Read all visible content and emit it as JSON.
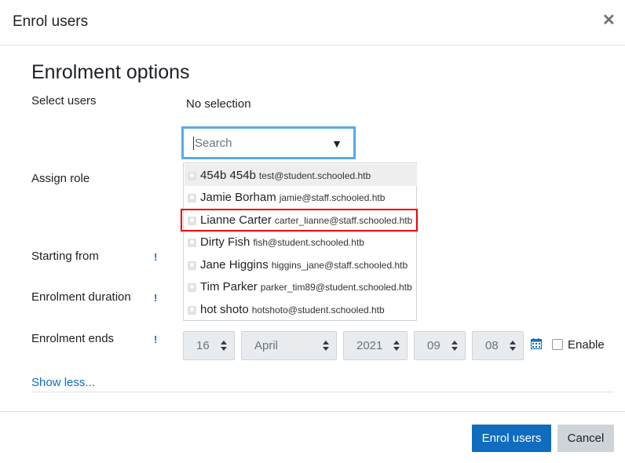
{
  "dialog": {
    "title": "Enrol users",
    "close_glyph": "✕"
  },
  "section_title": "Enrolment options",
  "fields": {
    "select_users": "Select users",
    "no_selection": "No selection",
    "search_placeholder": "Search",
    "assign_role": "Assign role",
    "starting_from": "Starting from",
    "enrolment_duration": "Enrolment duration",
    "enrolment_ends": "Enrolment ends",
    "help_glyph": "!"
  },
  "users": [
    {
      "name": "454b 454b",
      "email": "test@student.schooled.htb"
    },
    {
      "name": "Jamie Borham",
      "email": "jamie@staff.schooled.htb"
    },
    {
      "name": "Lianne Carter",
      "email": "carter_lianne@staff.schooled.htb"
    },
    {
      "name": "Dirty Fish",
      "email": "fish@student.schooled.htb"
    },
    {
      "name": "Jane Higgins",
      "email": "higgins_jane@staff.schooled.htb"
    },
    {
      "name": "Tim Parker",
      "email": "parker_tim89@student.schooled.htb"
    },
    {
      "name": "hot shoto",
      "email": "hotshoto@student.schooled.htb"
    }
  ],
  "highlighted_user_index": 2,
  "date": {
    "day": "16",
    "month": "April",
    "year": "2021",
    "hour": "09",
    "minute": "08",
    "enable_label": "Enable",
    "enable_checked": false
  },
  "show_less": "Show less...",
  "buttons": {
    "enrol": "Enrol users",
    "cancel": "Cancel"
  },
  "colors": {
    "primary": "#0f6cbf",
    "highlight_border": "#ee0000",
    "focus_border": "#5aa9e6"
  },
  "icons": {
    "close": "close-icon",
    "caret": "caret-down-icon",
    "calendar": "calendar-icon",
    "avatar": "user-avatar-icon"
  }
}
